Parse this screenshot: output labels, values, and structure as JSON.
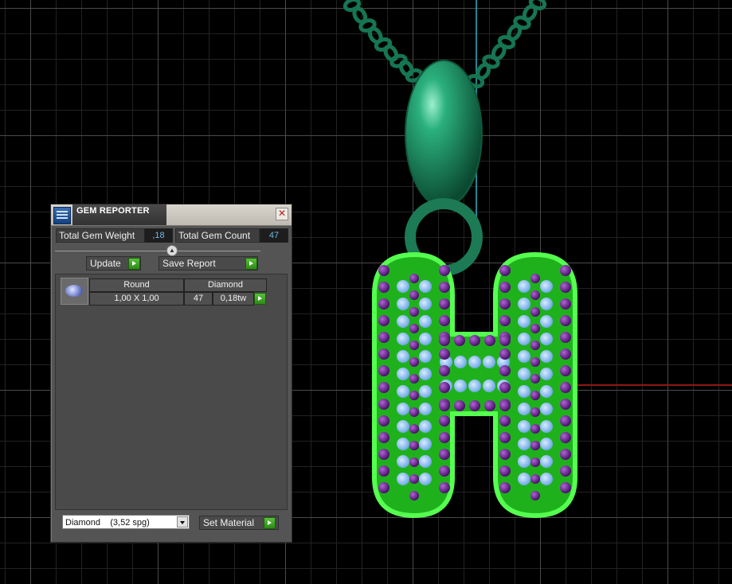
{
  "dialog": {
    "title": "GEM REPORTER",
    "close_symbol": "✕",
    "total_gem_weight_label": "Total Gem Weight",
    "total_gem_weight_value": ",18",
    "total_gem_count_label": "Total Gem Count",
    "total_gem_count_value": "47",
    "update_label": "Update",
    "save_report_label": "Save Report",
    "gem_row": {
      "shape": "Round",
      "material": "Diamond",
      "size": "1,00 X 1,00",
      "count": "47",
      "weight": "0,18tw"
    },
    "material_select_value": "Diamond    (3,52 spg)",
    "set_material_label": "Set Material"
  },
  "icons": {
    "app": "gem-reporter-icon",
    "close": "close-icon",
    "play": "play-arrow-icon",
    "collapse": "collapse-up-icon",
    "dropdown": "chevron-down-icon"
  },
  "colors": {
    "pendant_metal": "#1f8a5e",
    "pendant_glow": "#39e83a",
    "gem_blue": "#8ec6f5",
    "gem_purple": "#6b1f8f",
    "grid": "#4a4a4a",
    "axis_x": "#8a1a12",
    "axis_y": "#2aa7b5",
    "value_text": "#6fb8e8"
  }
}
